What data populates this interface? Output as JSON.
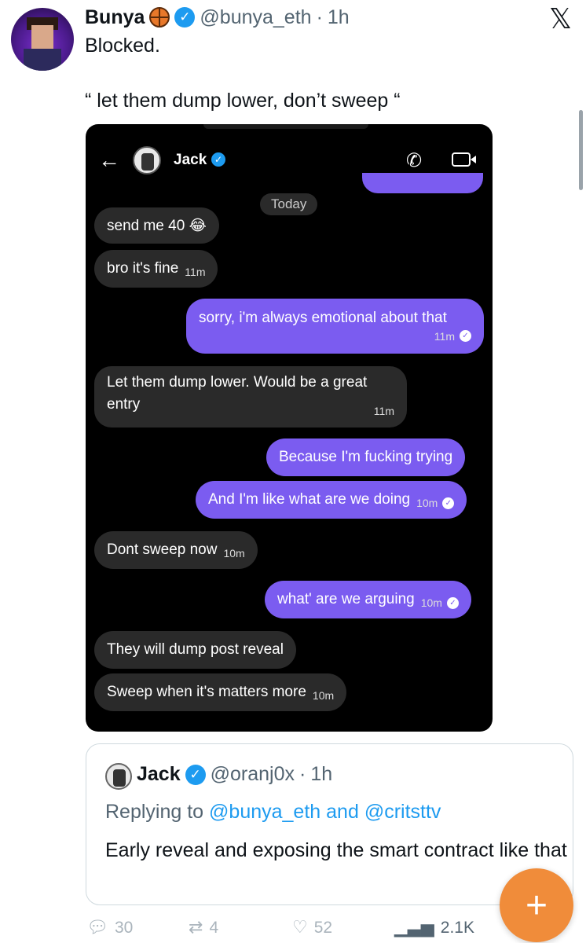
{
  "tweet": {
    "name": "Bunya",
    "handle": "@bunya_eth",
    "separator": "·",
    "time": "1h",
    "text": "Blocked.",
    "quote": "“ let them dump lower, don’t sweep “"
  },
  "chat": {
    "contact": "Jack",
    "date_divider": "Today",
    "messages": [
      {
        "side": "left",
        "text": "send me 40 😂",
        "time": ""
      },
      {
        "side": "left",
        "text": "bro it's fine",
        "time": "11m"
      },
      {
        "side": "right",
        "text": "sorry, i'm always emotional about that",
        "time": "11m"
      },
      {
        "side": "left",
        "text": "Let them dump lower. Would be a great",
        "text2": "entry",
        "time": "11m"
      },
      {
        "side": "right",
        "text": "Because I'm fucking trying",
        "time": ""
      },
      {
        "side": "right",
        "text": "And I'm like what are we doing",
        "time": "10m"
      },
      {
        "side": "left",
        "text": "Dont sweep now",
        "time": "10m"
      },
      {
        "side": "right",
        "text": "what' are we arguing",
        "time": "10m"
      },
      {
        "side": "left",
        "text": "They will dump post reveal",
        "time": ""
      },
      {
        "side": "left",
        "text": "Sweep when it's matters more",
        "time": "10m"
      }
    ]
  },
  "quoted_tweet": {
    "name": "Jack",
    "handle": "@oranj0x",
    "separator": "·",
    "time": "1h",
    "replying_prefix": "Replying to",
    "reply_to_1": "@bunya_eth",
    "reply_and": "and",
    "reply_to_2": "@critsttv",
    "text": "Early reveal and exposing the smart contract like that"
  },
  "actions": {
    "replies": "30",
    "reposts": "4",
    "likes": "52",
    "views": "2.1K"
  },
  "icons": {
    "x_logo": "x-logo-icon",
    "verified": "verified-badge-icon",
    "fab": "compose-plus-icon"
  }
}
